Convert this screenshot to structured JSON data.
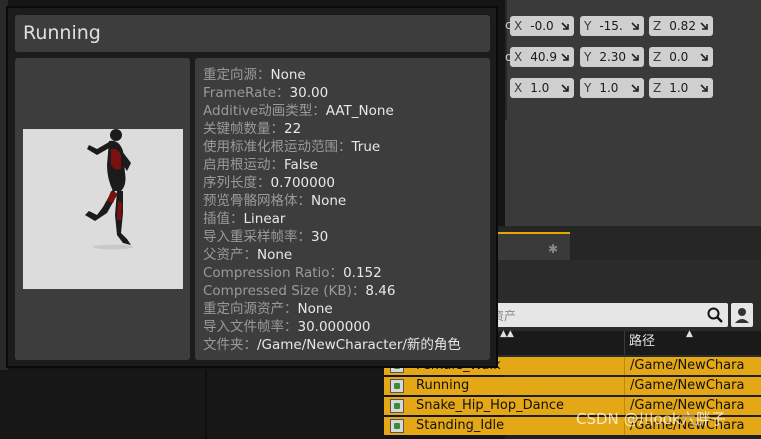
{
  "tooltip": {
    "title": "Running",
    "properties": [
      {
        "key": "重定向源：",
        "value": "None"
      },
      {
        "key": "FrameRate：",
        "value": "30.00"
      },
      {
        "key": "Additive动画类型：",
        "value": "AAT_None"
      },
      {
        "key": "关键帧数量：",
        "value": "22"
      },
      {
        "key": "使用标准化根运动范围：",
        "value": "True"
      },
      {
        "key": "启用根运动：",
        "value": "False"
      },
      {
        "key": "序列长度：",
        "value": "0.700000"
      },
      {
        "key": "预览骨骼网格体：",
        "value": "None"
      },
      {
        "key": "插值：",
        "value": "Linear"
      },
      {
        "key": "导入重采样帧率：",
        "value": "30"
      },
      {
        "key": "父资产：",
        "value": "None"
      },
      {
        "key": "Compression Ratio：",
        "value": "0.152"
      },
      {
        "key": "Compressed Size (KB)：",
        "value": "8.46"
      },
      {
        "key": "重定向源资产：",
        "value": "None"
      },
      {
        "key": "导入文件帧率：",
        "value": "30.000000"
      },
      {
        "key": "文件夹：",
        "value": "/Game/NewCharacter/新的角色"
      }
    ]
  },
  "details": {
    "rows": [
      {
        "label": "c",
        "x": "-0.0",
        "y": "-15.",
        "z": "0.82"
      },
      {
        "label": "o",
        "x": "40.9",
        "y": "2.30",
        "z": "0.0"
      },
      {
        "label": "",
        "x": "1.0",
        "y": "1.0",
        "z": "1.0"
      }
    ],
    "axis_labels": {
      "x": "X",
      "y": "Y",
      "z": "Z"
    }
  },
  "content_browser": {
    "search_placeholder": "资产",
    "column_path": "路径",
    "rows": [
      {
        "name": "Female_Walk",
        "path": "/Game/NewChara"
      },
      {
        "name": "Running",
        "path": "/Game/NewChara"
      },
      {
        "name": "Snake_Hip_Hop_Dance",
        "path": "/Game/NewChara"
      },
      {
        "name": "Standing_Idle",
        "path": "/Game/NewChara"
      }
    ]
  },
  "watermark": "CSDN @川ook六胖子",
  "colors": {
    "selection": "#e4a817",
    "panel": "#3d3d3d",
    "tab_accent": "#e8a500"
  }
}
